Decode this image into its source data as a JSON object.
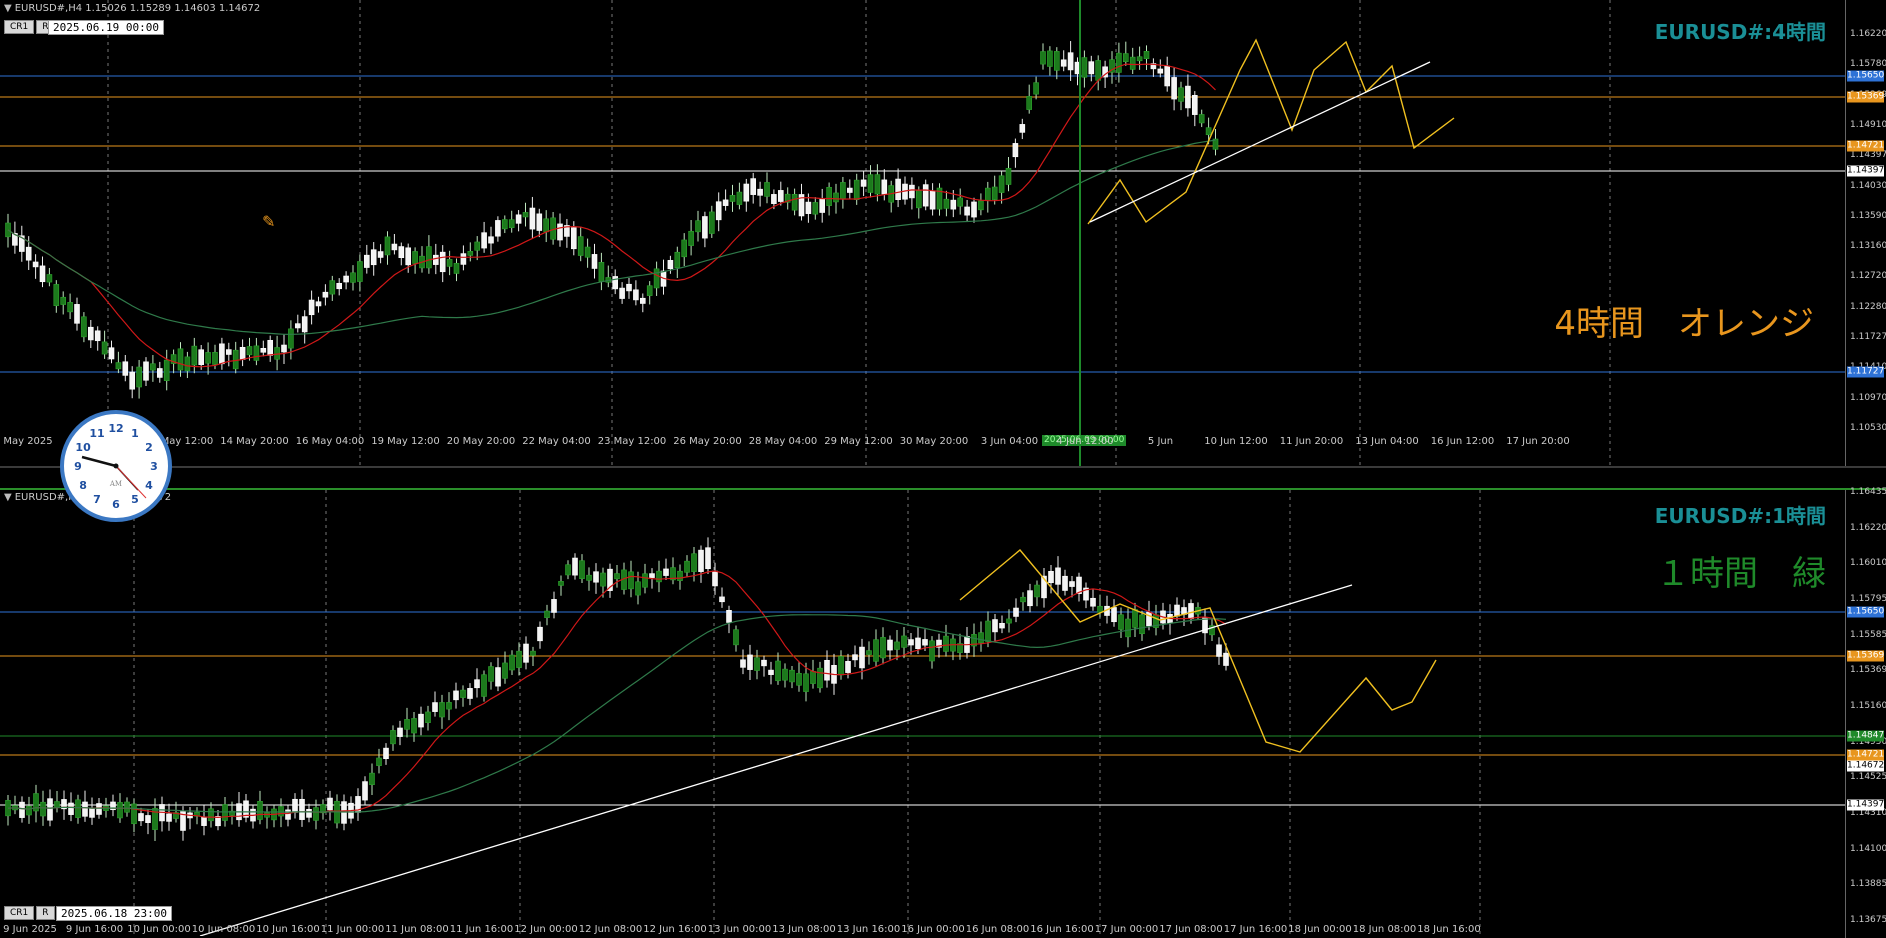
{
  "top_pane": {
    "header": "EURUSD#,H4  1.15026 1.15289 1.14603 1.14672",
    "tf_title": "EURUSD#:4時間",
    "note": "4時間　オレンジ",
    "date_box": "2025.06.19 00:00",
    "selected_time_label": "2025.06.09 00:00",
    "buttons": [
      "CR1",
      "R"
    ],
    "x_labels": [
      "May 2025",
      "9 May 12:00",
      "13 May 12:00",
      "14 May 20:00",
      "16 May 04:00",
      "19 May 12:00",
      "20 May 20:00",
      "22 May 04:00",
      "23 May 12:00",
      "26 May 20:00",
      "28 May 04:00",
      "29 May 12:00",
      "30 May 20:00",
      "3 Jun 04:00",
      "4 Jun 12:00",
      "5 Jun",
      "10 Jun 12:00",
      "11 Jun 20:00",
      "13 Jun 04:00",
      "16 Jun 12:00",
      "17 Jun 20:00"
    ],
    "y_labels": [
      "1.16220",
      "1.15780",
      "1.15369",
      "1.14910",
      "1.14397",
      "1.14030",
      "1.13590",
      "1.13160",
      "1.12720",
      "1.12280",
      "1.11727",
      "1.11410",
      "1.10970",
      "1.10530"
    ],
    "price_tags": [
      {
        "label": "1.15650",
        "color": "#2e72d6"
      },
      {
        "label": "1.15369",
        "color": "#e8961e"
      },
      {
        "label": "1.14721",
        "color": "#e8961e"
      },
      {
        "label": "1.14397",
        "color": "#ffffff"
      },
      {
        "label": "1.11727",
        "color": "#2e72d6"
      }
    ]
  },
  "bottom_pane": {
    "header": "EURUSD#,H1  1.14603 1.14672",
    "tf_title": "EURUSD#:1時間",
    "note": "１時間　緑",
    "date_box": "2025.06.18 23:00",
    "buttons": [
      "CR1",
      "R"
    ],
    "x_labels": [
      "9 Jun 2025",
      "9 Jun 16:00",
      "10 Jun 00:00",
      "10 Jun 08:00",
      "10 Jun 16:00",
      "11 Jun 00:00",
      "11 Jun 08:00",
      "11 Jun 16:00",
      "12 Jun 00:00",
      "12 Jun 08:00",
      "12 Jun 16:00",
      "13 Jun 00:00",
      "13 Jun 08:00",
      "13 Jun 16:00",
      "16 Jun 00:00",
      "16 Jun 08:00",
      "16 Jun 16:00",
      "17 Jun 00:00",
      "17 Jun 08:00",
      "17 Jun 16:00",
      "18 Jun 00:00",
      "18 Jun 08:00",
      "18 Jun 16:00"
    ],
    "y_labels": [
      "1.16435",
      "1.16220",
      "1.16010",
      "1.15795",
      "1.15585",
      "1.15369",
      "1.15160",
      "1.14950",
      "1.14525",
      "1.14310",
      "1.14100",
      "1.13885",
      "1.13675"
    ],
    "price_tags": [
      {
        "label": "1.15650",
        "color": "#2e72d6"
      },
      {
        "label": "1.15369",
        "color": "#e8961e"
      },
      {
        "label": "1.14847",
        "color": "#1f8a2a"
      },
      {
        "label": "1.14721",
        "color": "#e8961e"
      },
      {
        "label": "1.14672",
        "color": "#ffffff"
      },
      {
        "label": "1.14397",
        "color": "#ffffff"
      }
    ]
  },
  "clock": {
    "label": "AM"
  }
}
